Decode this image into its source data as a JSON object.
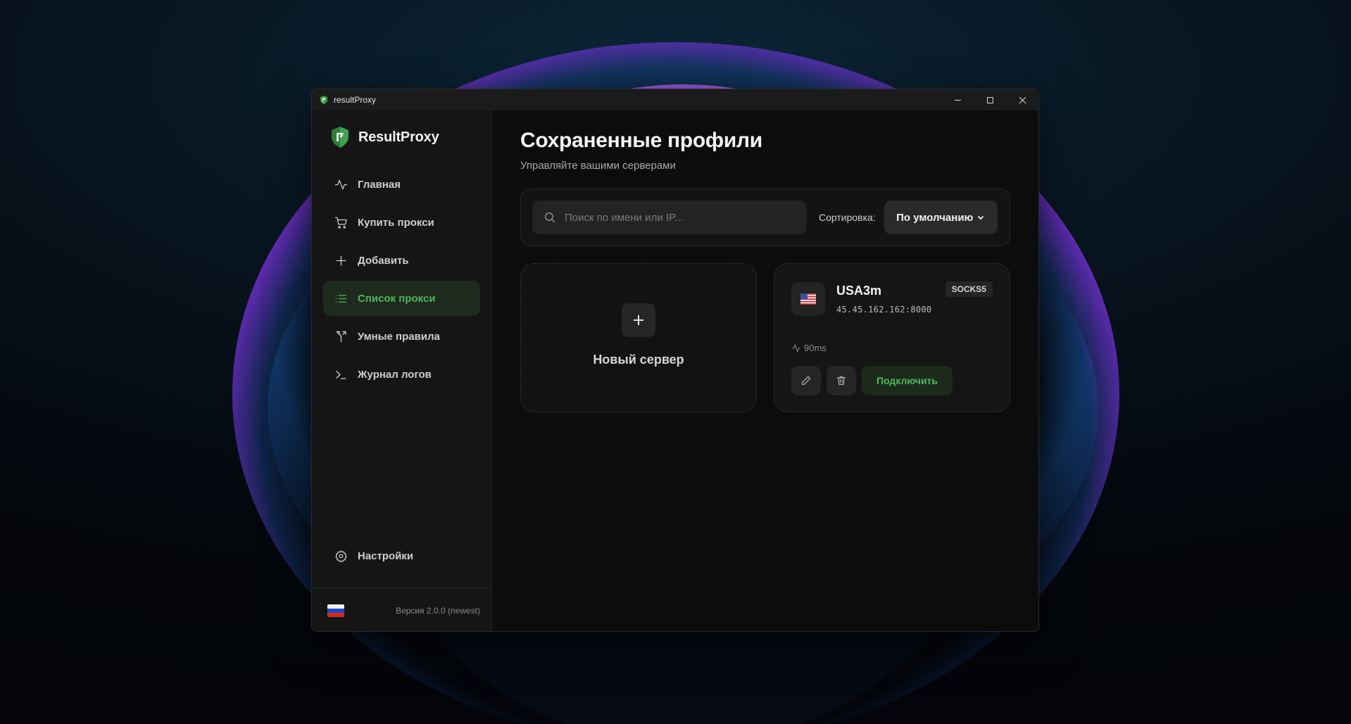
{
  "window": {
    "title": "resultProxy"
  },
  "sidebar": {
    "brand": "ResultProxy",
    "items": [
      {
        "label": "Главная",
        "icon": "activity-icon"
      },
      {
        "label": "Купить прокси",
        "icon": "cart-icon"
      },
      {
        "label": "Добавить",
        "icon": "plus-icon"
      },
      {
        "label": "Список прокси",
        "icon": "list-icon",
        "active": true
      },
      {
        "label": "Умные правила",
        "icon": "split-icon"
      },
      {
        "label": "Журнал логов",
        "icon": "terminal-icon"
      }
    ],
    "settings_label": "Настройки",
    "language_flag": "ru",
    "version": "Версия 2.0.0 (newest)"
  },
  "main": {
    "title": "Сохраненные профили",
    "subtitle": "Управляйте вашими серверами",
    "search": {
      "placeholder": "Поиск по имени или IP...",
      "value": ""
    },
    "sort": {
      "label": "Сортировка:",
      "value": "По умолчанию"
    },
    "new_server_label": "Новый сервер",
    "servers": [
      {
        "name": "USA3m",
        "address": "45.45.162.162:8000",
        "protocol": "SOCKS5",
        "ping": "90ms",
        "country_flag": "us",
        "connect_label": "Подключить"
      }
    ]
  },
  "colors": {
    "accent": "#4ab85a",
    "background": "#0c0c0c",
    "sidebar": "#151515"
  }
}
